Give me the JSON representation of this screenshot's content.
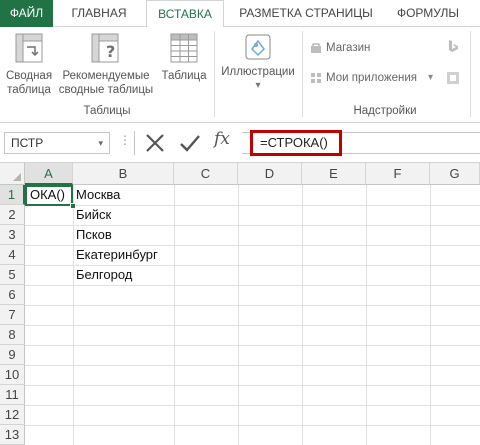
{
  "tabs": {
    "file": "ФАЙЛ",
    "home": "ГЛАВНАЯ",
    "insert": "ВСТАВКА",
    "page_layout": "РАЗМЕТКА СТРАНИЦЫ",
    "formulas": "ФОРМУЛЫ"
  },
  "ribbon": {
    "tables_group": {
      "label": "Таблицы",
      "pivot_line1": "Сводная",
      "pivot_line2": "таблица",
      "recommended_line1": "Рекомендуемые",
      "recommended_line2": "сводные таблицы",
      "table": "Таблица"
    },
    "illustrations": {
      "label": "Иллюстрации",
      "dropdown": "▾"
    },
    "addins_group": {
      "label": "Надстройки",
      "store": "Магазин",
      "my_apps": "Мои приложения",
      "my_apps_dropdown": "▾"
    }
  },
  "formula_bar": {
    "name_box": "ПСТР",
    "name_box_dropdown": "▾",
    "dots": "⋮",
    "fx": "fx",
    "formula": "=СТРОКА()"
  },
  "sheet": {
    "columns": [
      "A",
      "B",
      "C",
      "D",
      "E",
      "F",
      "G"
    ],
    "rows": [
      "1",
      "2",
      "3",
      "4",
      "5",
      "6",
      "7",
      "8",
      "9",
      "10",
      "11",
      "12",
      "13"
    ],
    "selected_column": "A",
    "selected_row": "1",
    "cells": {
      "A1": "ОКА()",
      "B1": "Москва",
      "B2": "Бийск",
      "B3": "Псков",
      "B4": "Екатеринбург",
      "B5": "Белгород"
    }
  },
  "colors": {
    "accent": "#217346",
    "highlight_border": "#c00000",
    "header_bg": "#f2f2f2"
  }
}
